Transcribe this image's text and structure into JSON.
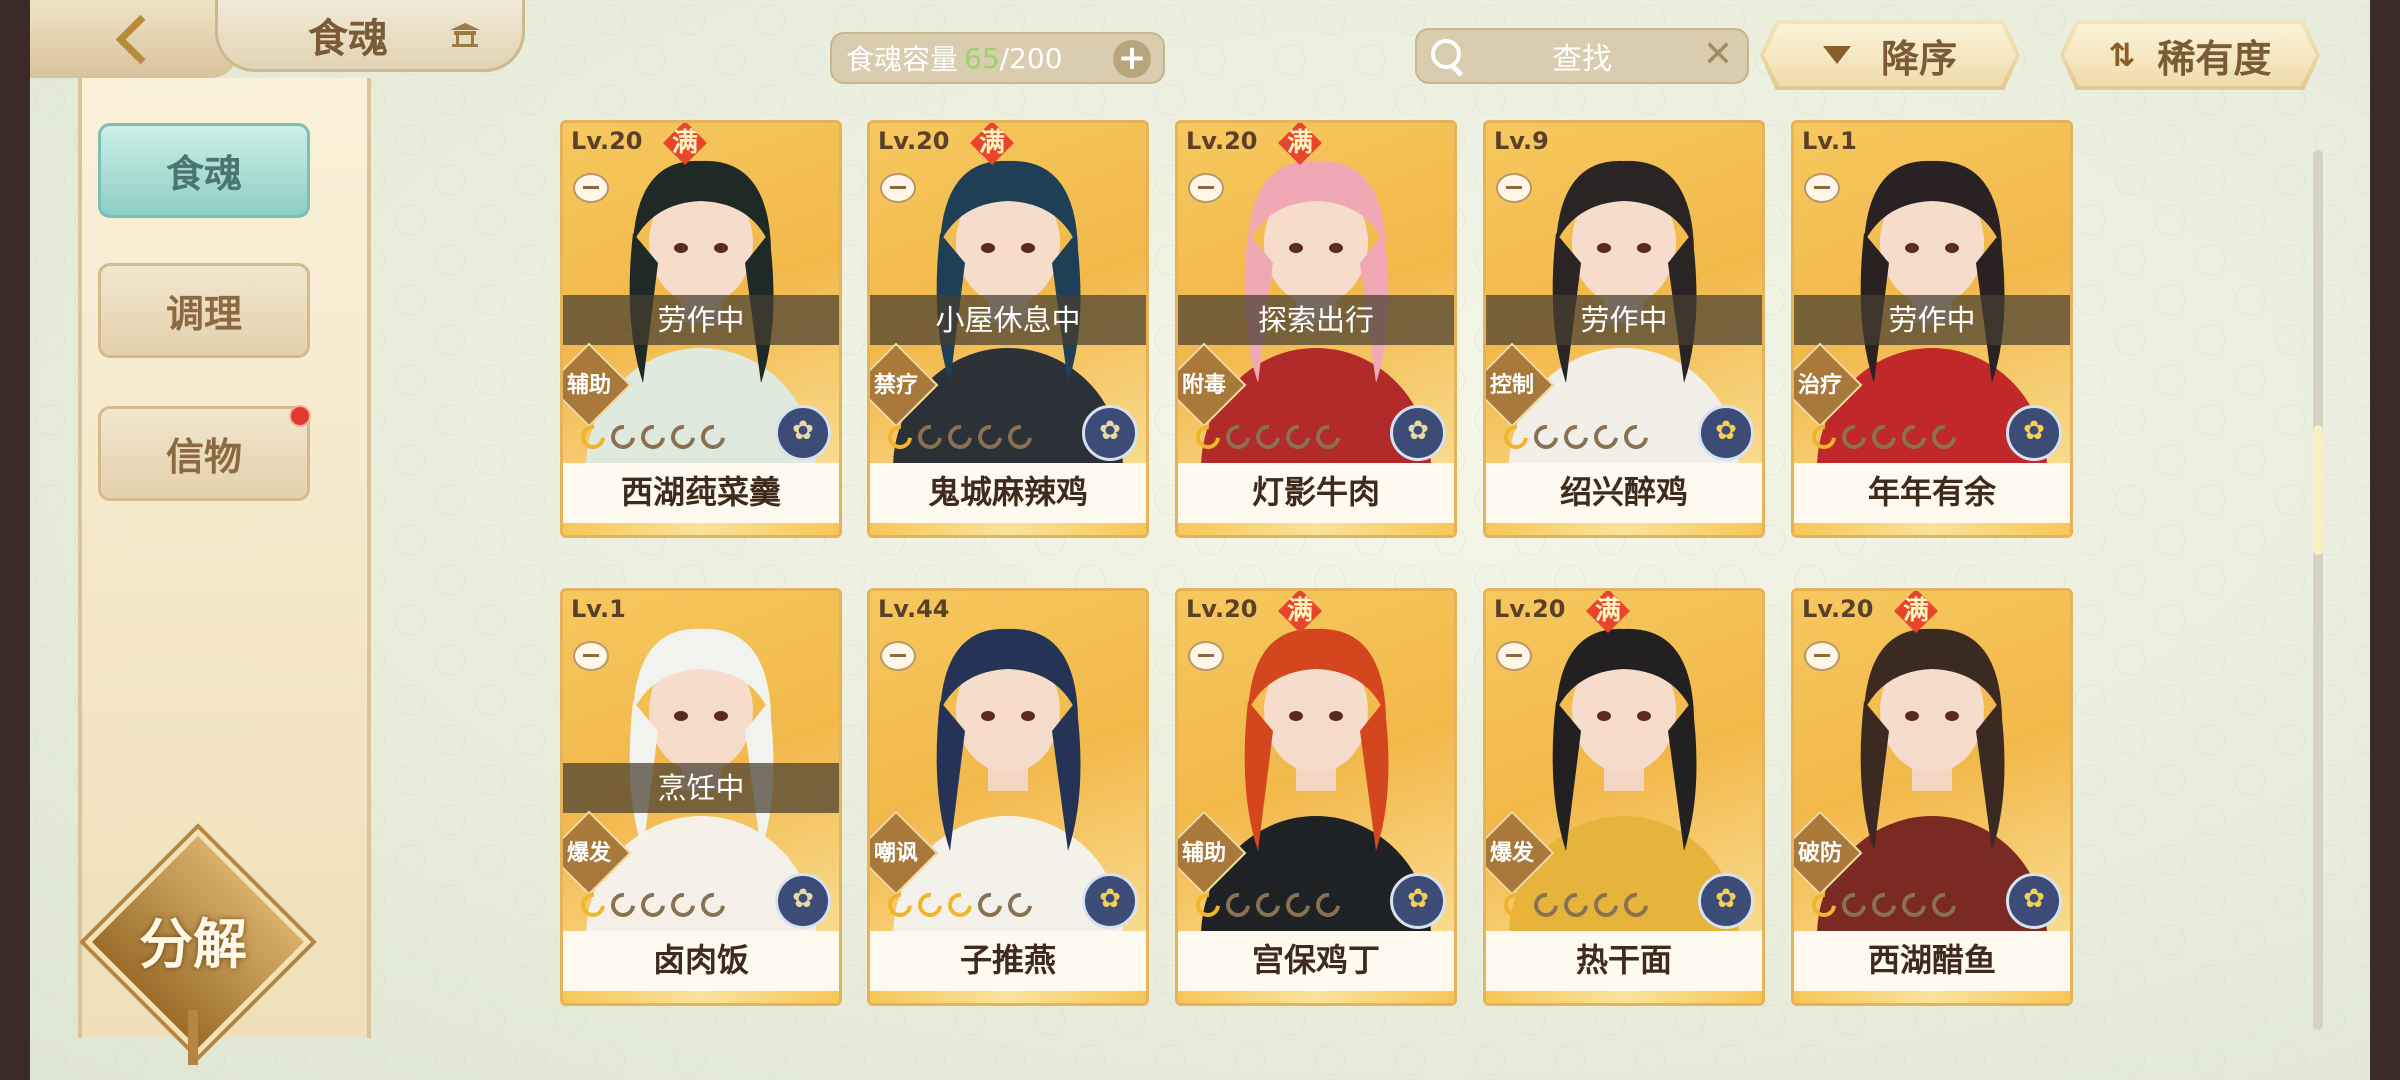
{
  "header": {
    "title": "食魂",
    "capacity": {
      "label": "食魂容量",
      "current": "65",
      "max": "/200"
    },
    "search_placeholder": "查找",
    "sort_order": "降序",
    "sort_key": "稀有度"
  },
  "sidebar": {
    "tabs": [
      {
        "label": "食魂",
        "active": true
      },
      {
        "label": "调理",
        "active": false
      },
      {
        "label": "信物",
        "active": false,
        "badge": true
      }
    ],
    "decompose_label": "分解"
  },
  "cards": [
    {
      "level": "Lv.20",
      "max": "满",
      "status": "劳作中",
      "role": "辅助",
      "stars_on": 1,
      "rarity_icon": "blue-flower",
      "name": "西湖莼菜羹",
      "hair": "#1f2a26",
      "outfit": "#dfe9dd"
    },
    {
      "level": "Lv.20",
      "max": "满",
      "status": "小屋休息中",
      "role": "禁疗",
      "stars_on": 1,
      "rarity_icon": "blue-flower",
      "name": "鬼城麻辣鸡",
      "hair": "#1e3f55",
      "outfit": "#2b3136"
    },
    {
      "level": "Lv.20",
      "max": "满",
      "status": "探索出行",
      "role": "附毒",
      "stars_on": 1,
      "rarity_icon": "blue-flower",
      "name": "灯影牛肉",
      "hair": "#f0a8b4",
      "outfit": "#b22a2a"
    },
    {
      "level": "Lv.9",
      "max": "",
      "status": "劳作中",
      "role": "控制",
      "stars_on": 1,
      "rarity_icon": "gold-flower",
      "name": "绍兴醉鸡",
      "hair": "#2b2424",
      "outfit": "#f1efe8"
    },
    {
      "level": "Lv.1",
      "max": "",
      "status": "劳作中",
      "role": "治疗",
      "stars_on": 1,
      "rarity_icon": "gold-flower",
      "name": "年年有余",
      "hair": "#2a2222",
      "outfit": "#c0282a"
    },
    {
      "level": "Lv.1",
      "max": "",
      "status": "烹饪中",
      "role": "爆发",
      "stars_on": 1,
      "rarity_icon": "blue-flower",
      "name": "卤肉饭",
      "hair": "#f2f2ee",
      "outfit": "#f6f1e8"
    },
    {
      "level": "Lv.44",
      "max": "",
      "status": "",
      "role": "嘲讽",
      "stars_on": 3,
      "rarity_icon": "gold-flower",
      "name": "子推燕",
      "hair": "#253456",
      "outfit": "#f4f1ea"
    },
    {
      "level": "Lv.20",
      "max": "满",
      "status": "",
      "role": "辅助",
      "stars_on": 1,
      "rarity_icon": "gold-flower",
      "name": "宫保鸡丁",
      "hair": "#d4461e",
      "outfit": "#1f2224"
    },
    {
      "level": "Lv.20",
      "max": "满",
      "status": "",
      "role": "爆发",
      "stars_on": 1,
      "rarity_icon": "gold-flower",
      "name": "热干面",
      "hair": "#222020",
      "outfit": "#e6b43a"
    },
    {
      "level": "Lv.20",
      "max": "满",
      "status": "",
      "role": "破防",
      "stars_on": 1,
      "rarity_icon": "gold-flower",
      "name": "西湖醋鱼",
      "hair": "#3b2a22",
      "outfit": "#7a2a22"
    }
  ],
  "colors": {
    "accent_gold": "#e7b35a",
    "active_tab": "#8ccfc5",
    "badge_red": "#e23b2d"
  }
}
